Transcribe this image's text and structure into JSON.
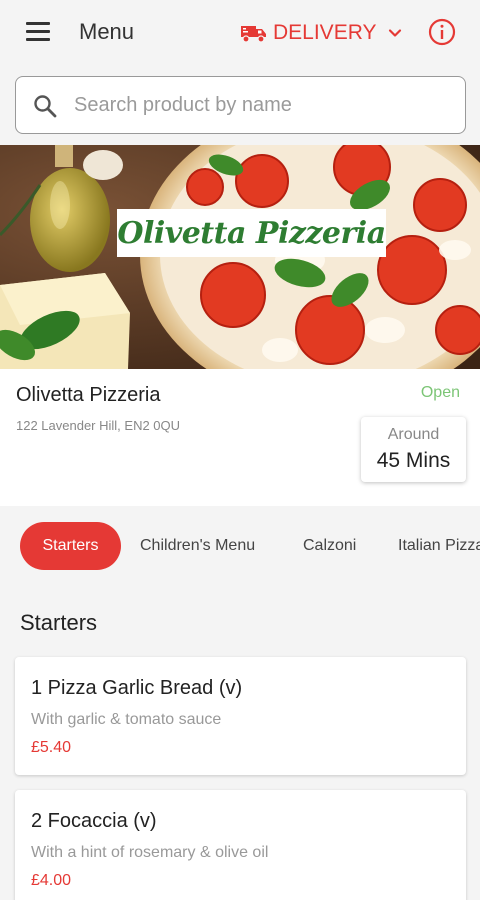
{
  "header": {
    "menu_label": "Menu",
    "delivery_label": "DELIVERY",
    "brand_color": "#e53935",
    "icons": [
      "hamburger-icon",
      "delivery-truck-icon",
      "chevron-down-icon",
      "info-icon"
    ]
  },
  "search": {
    "placeholder": "Search product by name",
    "value": ""
  },
  "hero": {
    "logo_text": "Olivetta Pizzeria"
  },
  "restaurant": {
    "name": "Olivetta Pizzeria",
    "address": "122 Lavender Hill, EN2 0QU",
    "status": "Open",
    "eta_label": "Around",
    "eta_value": "45  Mins"
  },
  "categories": [
    {
      "label": "Starters",
      "active": true
    },
    {
      "label": "Children's Menu",
      "active": false
    },
    {
      "label": "Calzoni",
      "active": false
    },
    {
      "label": "Italian Pizza",
      "active": false
    }
  ],
  "section": {
    "title": "Starters"
  },
  "products": [
    {
      "name": "1 Pizza Garlic Bread (v)",
      "description": "With garlic & tomato sauce",
      "price": "£5.40"
    },
    {
      "name": "2 Focaccia (v)",
      "description": "With a hint of rosemary & olive oil",
      "price": "£4.00"
    }
  ]
}
